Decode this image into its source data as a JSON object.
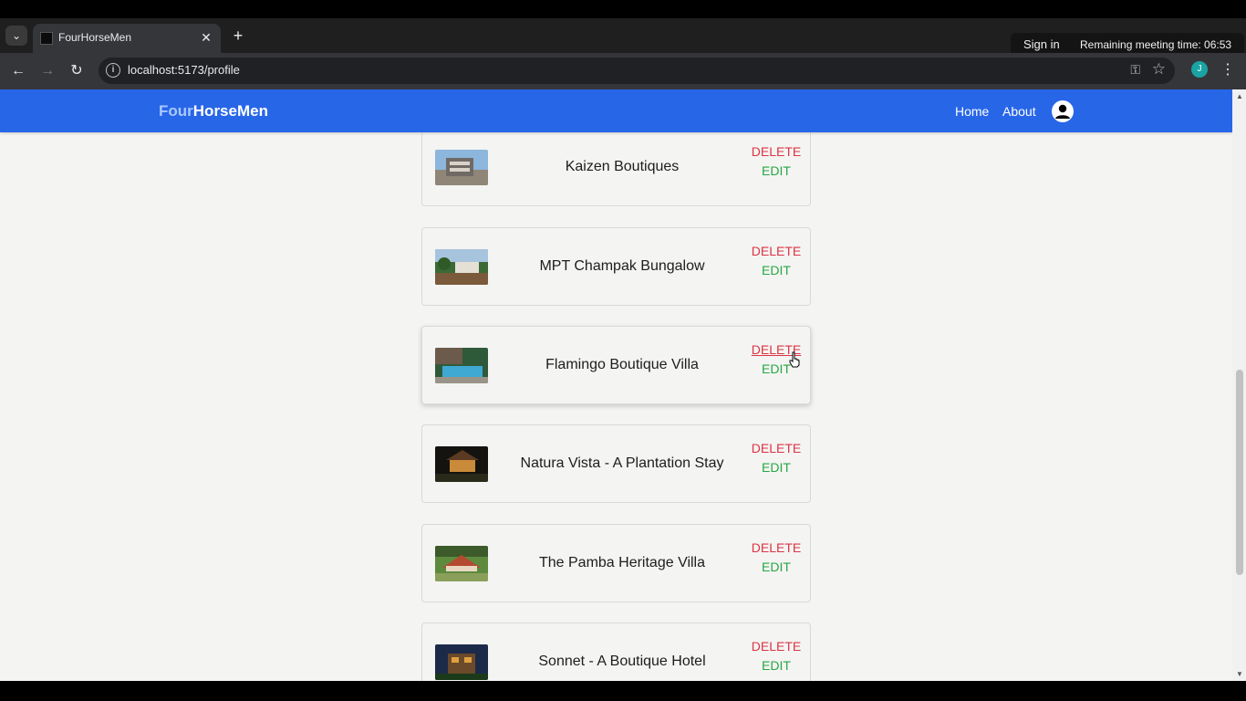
{
  "browser": {
    "tab_title": "FourHorseMen",
    "url": "localhost:5173/profile",
    "profile_initial": "J",
    "sign_in_label": "Sign in",
    "remaining_meeting_time": "Remaining meeting time: 06:53"
  },
  "navbar": {
    "brand_part1": "Four",
    "brand_part2": "HorseMen",
    "links": [
      {
        "label": "Home"
      },
      {
        "label": "About"
      }
    ]
  },
  "listings": [
    {
      "name": "Kaizen Boutiques",
      "delete_label": "DELETE",
      "edit_label": "EDIT"
    },
    {
      "name": "MPT Champak Bungalow",
      "delete_label": "DELETE",
      "edit_label": "EDIT"
    },
    {
      "name": "Flamingo Boutique Villa",
      "delete_label": "DELETE",
      "edit_label": "EDIT"
    },
    {
      "name": "Natura Vista - A Plantation Stay",
      "delete_label": "DELETE",
      "edit_label": "EDIT"
    },
    {
      "name": "The Pamba Heritage Villa",
      "delete_label": "DELETE",
      "edit_label": "EDIT"
    },
    {
      "name": "Sonnet - A Boutique Hotel",
      "delete_label": "DELETE",
      "edit_label": "EDIT"
    }
  ],
  "colors": {
    "navbar": "#2866e8",
    "delete": "#dc3545",
    "edit": "#28a745"
  }
}
